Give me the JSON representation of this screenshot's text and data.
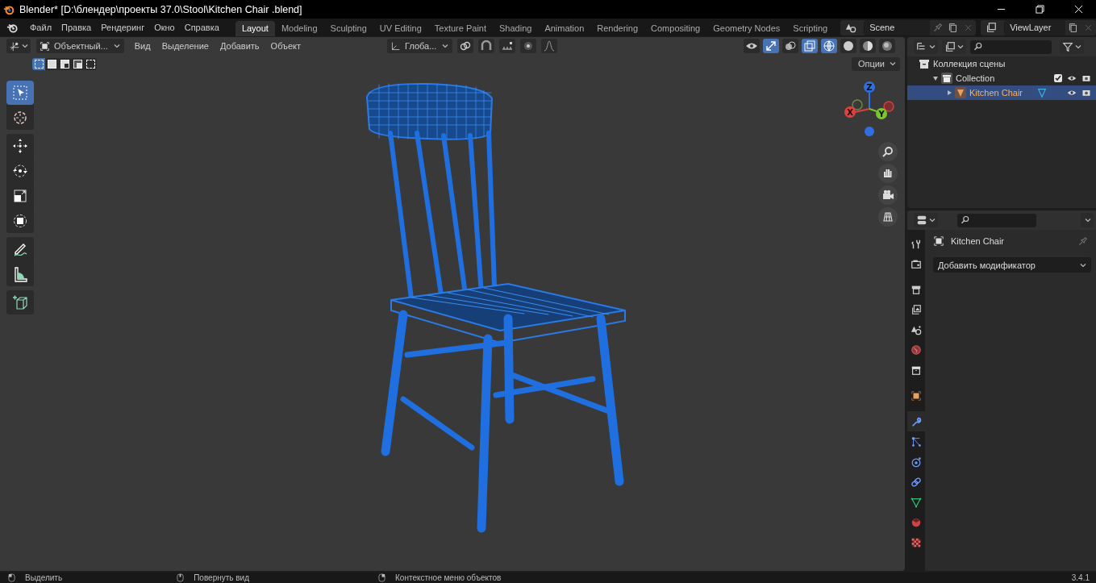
{
  "window": {
    "title": "Blender* [D:\\блендер\\проекты 37.0\\Stool\\Kitchen Chair .blend]"
  },
  "menu": [
    "Файл",
    "Правка",
    "Рендеринг",
    "Окно",
    "Справка"
  ],
  "workspaces": [
    {
      "label": "Layout",
      "selected": true
    },
    {
      "label": "Modeling",
      "selected": false
    },
    {
      "label": "Sculpting",
      "selected": false
    },
    {
      "label": "UV Editing",
      "selected": false
    },
    {
      "label": "Texture Paint",
      "selected": false
    },
    {
      "label": "Shading",
      "selected": false
    },
    {
      "label": "Animation",
      "selected": false
    },
    {
      "label": "Rendering",
      "selected": false
    },
    {
      "label": "Compositing",
      "selected": false
    },
    {
      "label": "Geometry Nodes",
      "selected": false
    },
    {
      "label": "Scripting",
      "selected": false
    }
  ],
  "scene": {
    "value": "Scene"
  },
  "view_layer": {
    "value": "ViewLayer"
  },
  "viewport": {
    "mode": "Объектный...",
    "menus": [
      "Вид",
      "Выделение",
      "Добавить",
      "Объект"
    ],
    "orientation": "Глоба...",
    "options": "Опции",
    "select_modes": [
      {
        "selected": true
      },
      {
        "selected": false
      },
      {
        "selected": false
      },
      {
        "selected": false
      },
      {
        "selected": false
      }
    ],
    "tool_groups": [
      [
        {
          "kind": "select",
          "selected": true
        },
        {
          "kind": "cursor",
          "selected": false
        }
      ],
      [
        {
          "kind": "move",
          "selected": false
        },
        {
          "kind": "rotate",
          "selected": false
        },
        {
          "kind": "scale",
          "selected": false
        },
        {
          "kind": "transform",
          "selected": false
        }
      ],
      [
        {
          "kind": "annotate",
          "selected": false
        },
        {
          "kind": "measure",
          "selected": false
        }
      ],
      [
        {
          "kind": "add-cube",
          "selected": false
        }
      ]
    ],
    "gizmo": {
      "x": "X",
      "y": "Y",
      "z": "Z"
    }
  },
  "outliner": {
    "items": [
      {
        "label": "Коллекция сцены",
        "kind": "scene-collection",
        "selected": false,
        "children": [
          {
            "label": "Collection",
            "kind": "collection",
            "expanded": true,
            "checked": true,
            "selected": false,
            "children": [
              {
                "label": "Kitchen Chair",
                "kind": "mesh-object",
                "expanded": false,
                "selected": true
              }
            ]
          }
        ]
      }
    ]
  },
  "properties": {
    "object_name": "Kitchen Chair",
    "add_modifier": "Добавить модификатор",
    "tabs": [
      {
        "kind": "tool",
        "selected": false
      },
      {
        "kind": "render",
        "selected": false
      },
      {
        "kind": "output",
        "selected": false
      },
      {
        "kind": "view-layer",
        "selected": false
      },
      {
        "kind": "scene",
        "selected": false
      },
      {
        "kind": "world",
        "selected": false
      },
      {
        "kind": "collection",
        "selected": false
      },
      {
        "kind": "object",
        "selected": false
      },
      {
        "kind": "modifier",
        "selected": true
      },
      {
        "kind": "particles",
        "selected": false
      },
      {
        "kind": "physics",
        "selected": false
      },
      {
        "kind": "constraints",
        "selected": false
      },
      {
        "kind": "data",
        "selected": false
      },
      {
        "kind": "material",
        "selected": false
      },
      {
        "kind": "texture",
        "selected": false
      }
    ]
  },
  "status_bar": {
    "hints": [
      "Выделить",
      "Повернуть вид",
      "Контекстное меню объектов"
    ],
    "version": "3.4.1"
  }
}
